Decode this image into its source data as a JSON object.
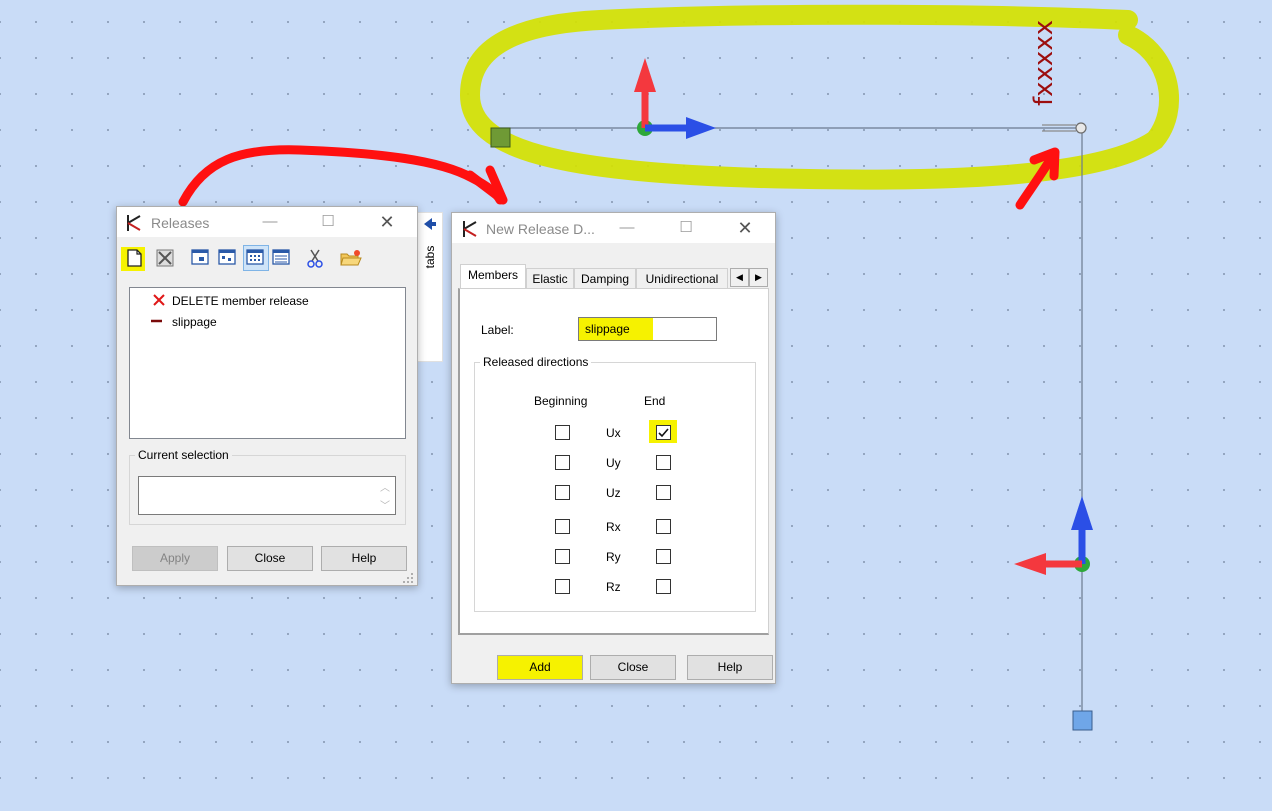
{
  "colors": {
    "canvas": "#c9dcf7",
    "highlight": "#f6f200",
    "annotation": "#ff1010",
    "structure_line": "#6c7a8e",
    "axis_red": "#f4383e",
    "axis_blue": "#2b4fe6",
    "axis_green": "#2ea83a"
  },
  "canvas": {
    "member_label": "fxxxxx"
  },
  "releases_window": {
    "title": "Releases",
    "toolbar_icons": [
      "new-document-icon",
      "delete-icon",
      "view-1-icon",
      "view-2-icon",
      "view-3-icon",
      "list-view-icon",
      "cut-icon",
      "open-folder-icon"
    ],
    "list_items": [
      {
        "icon": "delete-x-icon",
        "label": "DELETE member release"
      },
      {
        "icon": "release-line-icon",
        "label": "slippage"
      }
    ],
    "current_selection_label": "Current selection",
    "current_selection_value": "",
    "buttons": {
      "apply": "Apply",
      "close": "Close",
      "help": "Help"
    }
  },
  "side_tab": {
    "label": "tabs"
  },
  "new_release_window": {
    "title": "New Release D...",
    "tabs": [
      "Members",
      "Elastic",
      "Damping",
      "Unidirectional"
    ],
    "active_tab": "Members",
    "label_caption": "Label:",
    "label_value": "slippage",
    "group_title": "Released directions",
    "col_beginning": "Beginning",
    "col_end": "End",
    "directions": [
      {
        "name": "Ux",
        "beginning": false,
        "end": true
      },
      {
        "name": "Uy",
        "beginning": false,
        "end": false
      },
      {
        "name": "Uz",
        "beginning": false,
        "end": false
      },
      {
        "name": "Rx",
        "beginning": false,
        "end": false
      },
      {
        "name": "Ry",
        "beginning": false,
        "end": false
      },
      {
        "name": "Rz",
        "beginning": false,
        "end": false
      }
    ],
    "buttons": {
      "add": "Add",
      "close": "Close",
      "help": "Help"
    }
  }
}
